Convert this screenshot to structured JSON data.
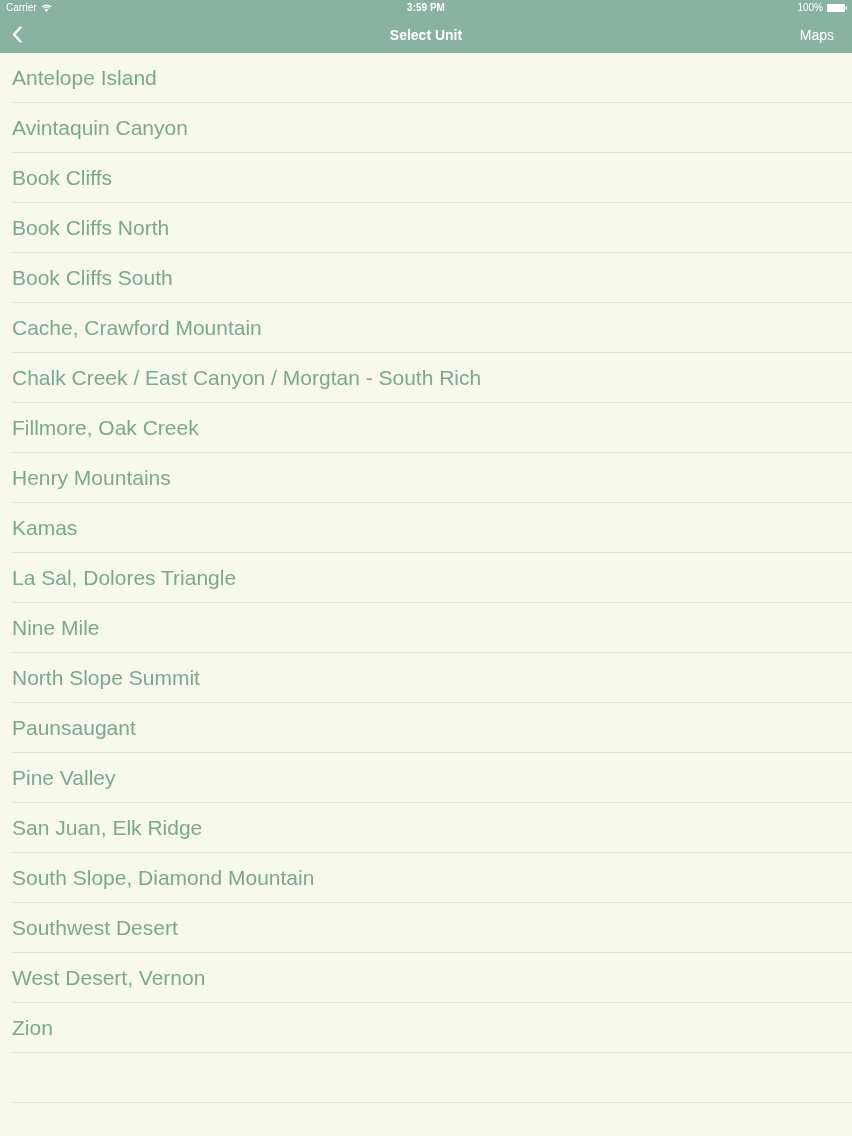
{
  "status_bar": {
    "carrier": "Carrier",
    "time": "3:59 PM",
    "battery": "100%"
  },
  "nav_bar": {
    "title": "Select Unit",
    "right_button": "Maps"
  },
  "units": [
    "Antelope Island",
    "Avintaquin Canyon",
    "Book Cliffs",
    "Book Cliffs North",
    "Book Cliffs South",
    "Cache, Crawford Mountain",
    "Chalk Creek / East Canyon / Morgtan - South Rich",
    "Fillmore, Oak Creek",
    "Henry Mountains",
    "Kamas",
    "La Sal, Dolores Triangle",
    "Nine Mile",
    "North Slope Summit",
    "Paunsaugant",
    "Pine Valley",
    "San Juan, Elk Ridge",
    "South Slope, Diamond Mountain",
    "Southwest Desert",
    "West Desert, Vernon",
    "Zion"
  ]
}
